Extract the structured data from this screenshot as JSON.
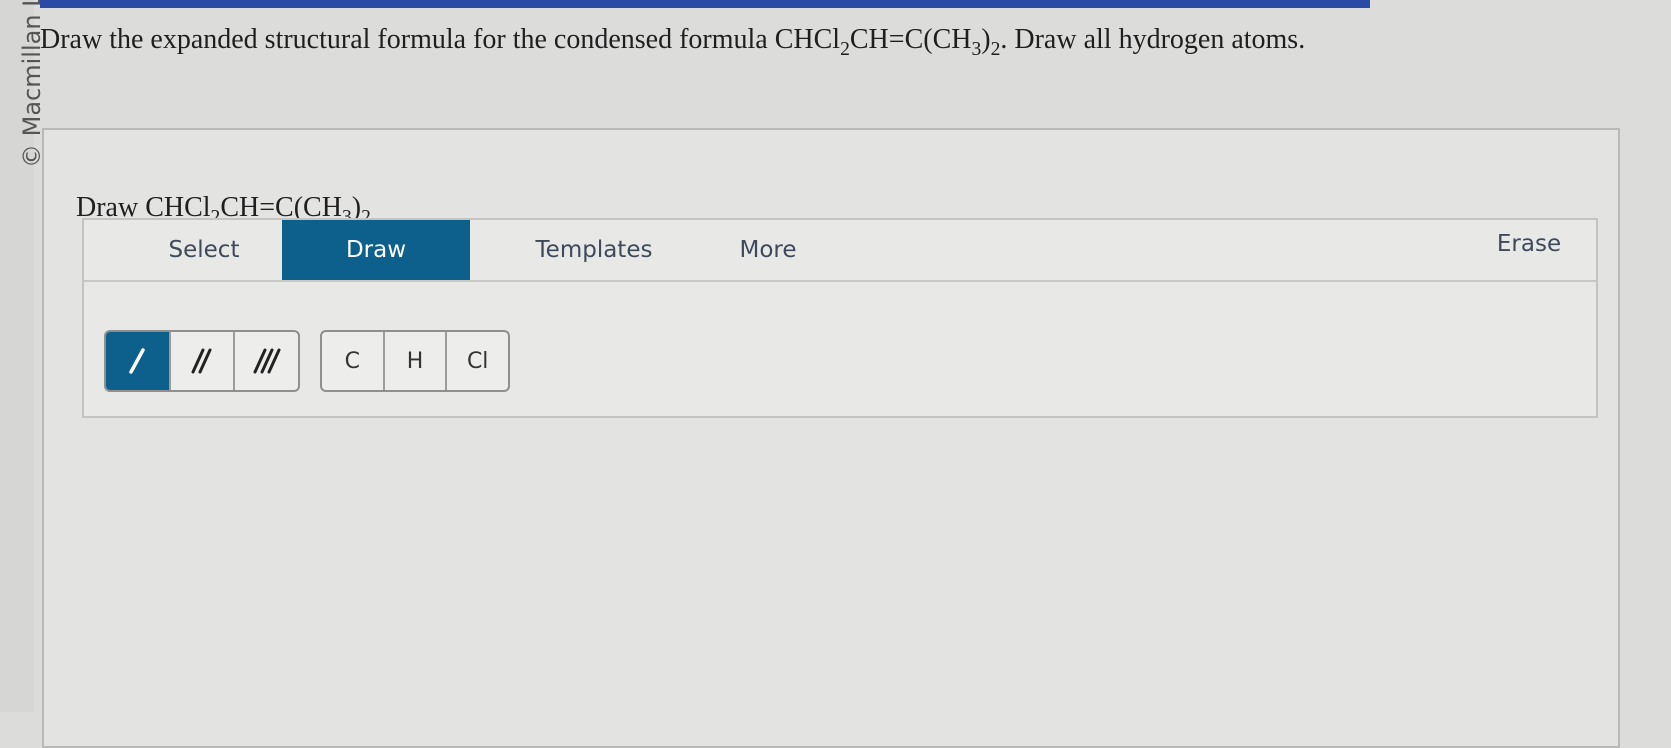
{
  "sidebar": {
    "copyright": "© Macmillan Lea"
  },
  "question": {
    "prefix": "Draw the expanded structural formula for the condensed formula CHCl",
    "sub1": "2",
    "mid1": "CH=C(CH",
    "sub2": "3",
    "mid2": ")",
    "sub3": "2",
    "suffix": ". Draw all hydrogen atoms."
  },
  "panel": {
    "title_prefix": "Draw CHCl",
    "title_sub1": "2",
    "title_mid1": "CH=C(CH",
    "title_sub2": "3",
    "title_mid2": ")",
    "title_sub3": "2"
  },
  "tabs": {
    "select": "Select",
    "draw": "Draw",
    "templates": "Templates",
    "more": "More",
    "erase": "Erase"
  },
  "tools": {
    "bonds": [
      {
        "name": "single-bond",
        "icon": "single-bond-icon"
      },
      {
        "name": "double-bond",
        "icon": "double-bond-icon"
      },
      {
        "name": "triple-bond",
        "icon": "triple-bond-icon"
      }
    ],
    "atoms": {
      "carbon": "C",
      "hydrogen": "H",
      "chlorine": "Cl"
    }
  },
  "colors": {
    "accent": "#0d5f8c",
    "top_bar": "#2b4aa6"
  }
}
